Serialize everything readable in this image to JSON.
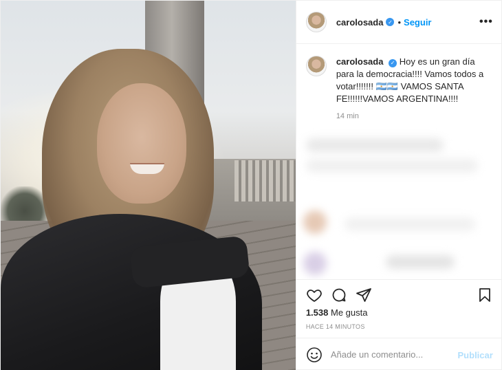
{
  "post": {
    "username": "carolosada",
    "follow_label": "Seguir",
    "more_icon": "more-options-icon",
    "caption": {
      "text": "Hoy es un gran día para la democracia!!!! Vamos todos a votar!!!!!!! 🇦🇷🇦🇷 VAMOS SANTA FE!!!!!!VAMOS ARGENTINA!!!!",
      "time": "14 min"
    },
    "likes_count": "1.538",
    "likes_label": "Me gusta",
    "posted_ago": "HACE 14 MINUTOS",
    "comment": {
      "placeholder": "Añade un comentario...",
      "publish_label": "Publicar"
    }
  },
  "colors": {
    "link_blue": "#0095f6",
    "publish_disabled": "#b2dffc",
    "verified_badge": "#3897f0",
    "muted_text": "#8e8e8e"
  },
  "icons": {
    "like": "heart-icon",
    "comment": "comment-bubble-icon",
    "share": "paper-plane-icon",
    "save": "bookmark-icon",
    "emoji": "smiley-icon",
    "verified": "verified-badge-icon"
  }
}
